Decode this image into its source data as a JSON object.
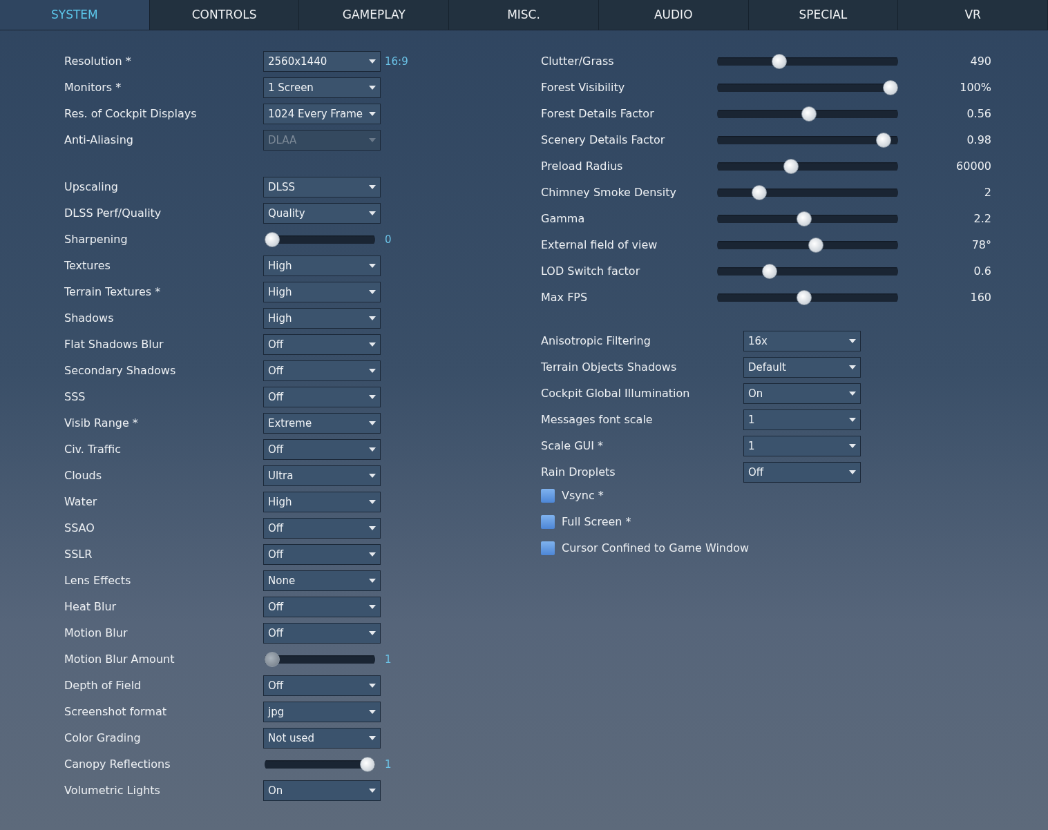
{
  "tabs": [
    {
      "label": "SYSTEM",
      "selected": true
    },
    {
      "label": "CONTROLS",
      "selected": false
    },
    {
      "label": "GAMEPLAY",
      "selected": false
    },
    {
      "label": "MISC.",
      "selected": false
    },
    {
      "label": "AUDIO",
      "selected": false
    },
    {
      "label": "SPECIAL",
      "selected": false
    },
    {
      "label": "VR",
      "selected": false
    }
  ],
  "left": {
    "groups": [
      {
        "rows": [
          {
            "kind": "select",
            "label": "Resolution *",
            "value": "2560x1440",
            "disabled": false,
            "note": "16:9"
          },
          {
            "kind": "select",
            "label": "Monitors *",
            "value": "1 Screen",
            "disabled": false
          },
          {
            "kind": "select",
            "label": "Res. of Cockpit Displays",
            "value": "1024 Every Frame",
            "disabled": false
          },
          {
            "kind": "select",
            "label": "Anti-Aliasing",
            "value": "DLAA",
            "disabled": true
          }
        ]
      },
      {
        "rows": [
          {
            "kind": "select",
            "label": "Upscaling",
            "value": "DLSS",
            "disabled": false
          },
          {
            "kind": "select",
            "label": "DLSS Perf/Quality",
            "value": "Quality",
            "disabled": false
          },
          {
            "kind": "slider",
            "label": "Sharpening",
            "level": 0,
            "reading": "0",
            "disabled": false
          },
          {
            "kind": "select",
            "label": "Textures",
            "value": "High",
            "disabled": false
          },
          {
            "kind": "select",
            "label": "Terrain Textures *",
            "value": "High",
            "disabled": false
          },
          {
            "kind": "select",
            "label": "Shadows",
            "value": "High",
            "disabled": false
          },
          {
            "kind": "select",
            "label": "Flat Shadows Blur",
            "value": "Off",
            "disabled": false
          },
          {
            "kind": "select",
            "label": "Secondary Shadows",
            "value": "Off",
            "disabled": false
          },
          {
            "kind": "select",
            "label": "SSS",
            "value": "Off",
            "disabled": false
          },
          {
            "kind": "select",
            "label": "Visib Range *",
            "value": "Extreme",
            "disabled": false
          },
          {
            "kind": "select",
            "label": "Civ. Traffic",
            "value": "Off",
            "disabled": false
          },
          {
            "kind": "select",
            "label": "Clouds",
            "value": "Ultra",
            "disabled": false
          },
          {
            "kind": "select",
            "label": "Water",
            "value": "High",
            "disabled": false
          },
          {
            "kind": "select",
            "label": "SSAO",
            "value": "Off",
            "disabled": false
          },
          {
            "kind": "select",
            "label": "SSLR",
            "value": "Off",
            "disabled": false
          },
          {
            "kind": "select",
            "label": "Lens Effects",
            "value": "None",
            "disabled": false
          },
          {
            "kind": "select",
            "label": "Heat Blur",
            "value": "Off",
            "disabled": false
          },
          {
            "kind": "select",
            "label": "Motion Blur",
            "value": "Off",
            "disabled": false
          },
          {
            "kind": "slider",
            "label": "Motion Blur Amount",
            "level": 0,
            "reading": "1",
            "disabled": true
          },
          {
            "kind": "select",
            "label": "Depth of Field",
            "value": "Off",
            "disabled": false
          },
          {
            "kind": "select",
            "label": "Screenshot format",
            "value": "jpg",
            "disabled": false
          },
          {
            "kind": "select",
            "label": "Color Grading",
            "value": "Not used",
            "disabled": false
          },
          {
            "kind": "slider",
            "label": "Canopy Reflections",
            "level": 1,
            "reading": "1",
            "disabled": false
          },
          {
            "kind": "select",
            "label": "Volumetric Lights",
            "value": "On",
            "disabled": false
          }
        ]
      }
    ]
  },
  "right": {
    "sliders": [
      {
        "label": "Clutter/Grass",
        "level": 0.33,
        "reading": "490"
      },
      {
        "label": "Forest Visibility",
        "level": 1,
        "reading": "100%"
      },
      {
        "label": "Forest Details Factor",
        "level": 0.51,
        "reading": "0.56"
      },
      {
        "label": "Scenery Details Factor",
        "level": 0.96,
        "reading": "0.98"
      },
      {
        "label": "Preload Radius",
        "level": 0.4,
        "reading": "60000"
      },
      {
        "label": "Chimney Smoke Density",
        "level": 0.21,
        "reading": "2"
      },
      {
        "label": "Gamma",
        "level": 0.48,
        "reading": "2.2"
      },
      {
        "label": "External field of view",
        "level": 0.55,
        "reading": "78°"
      },
      {
        "label": "LOD Switch factor",
        "level": 0.27,
        "reading": "0.6"
      },
      {
        "label": "Max FPS",
        "level": 0.48,
        "reading": "160"
      }
    ],
    "selects": [
      {
        "label": "Anisotropic Filtering",
        "value": "16x"
      },
      {
        "label": "Terrain Objects Shadows",
        "value": "Default"
      },
      {
        "label": "Cockpit Global Illumination",
        "value": "On"
      },
      {
        "label": "Messages font scale",
        "value": "1"
      },
      {
        "label": "Scale GUI *",
        "value": "1"
      },
      {
        "label": "Rain Droplets",
        "value": "Off"
      }
    ],
    "checkboxes": [
      {
        "label": "Vsync *",
        "checked": false
      },
      {
        "label": "Full Screen *",
        "checked": false
      },
      {
        "label": "Cursor Confined to Game Window",
        "checked": false
      }
    ]
  }
}
